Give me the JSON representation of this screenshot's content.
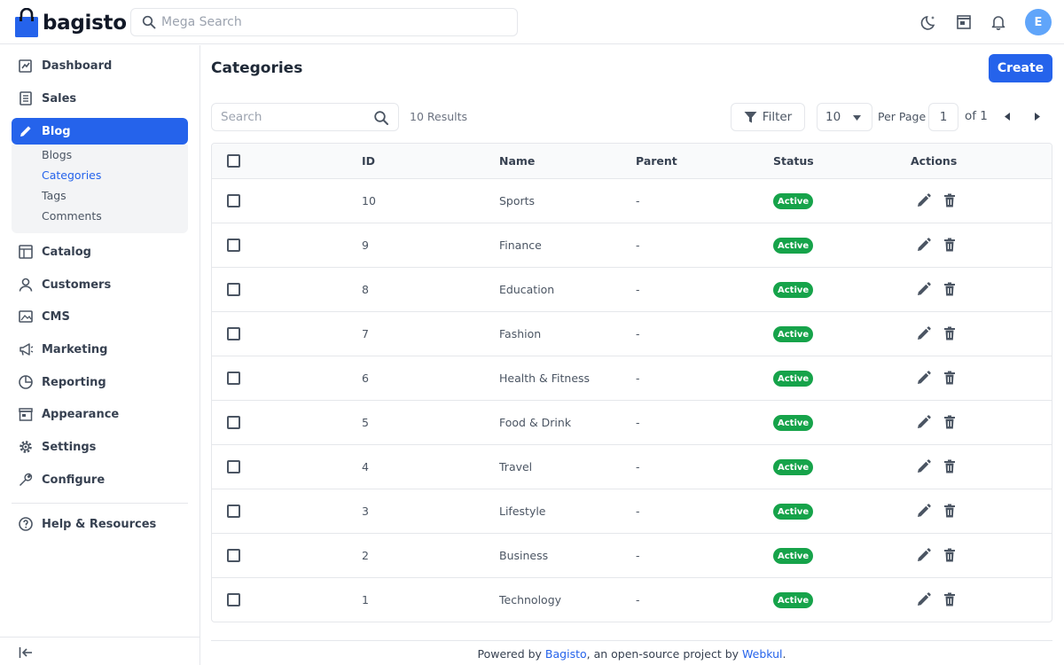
{
  "brand": {
    "name": "bagisto",
    "accent": "#2563eb"
  },
  "top_search": {
    "placeholder": "Mega Search"
  },
  "user": {
    "initial": "E"
  },
  "sidebar": {
    "items": [
      {
        "label": "Dashboard",
        "icon": "dashboard-icon"
      },
      {
        "label": "Sales",
        "icon": "sales-icon"
      },
      {
        "label": "Blog",
        "icon": "pencil-icon",
        "active": true
      },
      {
        "label": "Catalog",
        "icon": "catalog-icon"
      },
      {
        "label": "Customers",
        "icon": "customer-icon"
      },
      {
        "label": "CMS",
        "icon": "cms-icon"
      },
      {
        "label": "Marketing",
        "icon": "megaphone-icon"
      },
      {
        "label": "Reporting",
        "icon": "chart-icon"
      },
      {
        "label": "Appearance",
        "icon": "store-icon"
      },
      {
        "label": "Settings",
        "icon": "gear-icon"
      },
      {
        "label": "Configure",
        "icon": "wrench-icon"
      },
      {
        "label": "Help & Resources",
        "icon": "help-icon"
      }
    ],
    "blog_sub": [
      {
        "label": "Blogs"
      },
      {
        "label": "Categories",
        "current": true
      },
      {
        "label": "Tags"
      },
      {
        "label": "Comments"
      }
    ]
  },
  "page": {
    "title": "Categories",
    "create_label": "Create",
    "search_placeholder": "Search",
    "results_text": "10 Results",
    "filter_label": "Filter",
    "per_page_value": "10",
    "per_page_label": "Per Page",
    "page_value": "1",
    "of_label": "of 1"
  },
  "table": {
    "headers": {
      "id": "ID",
      "name": "Name",
      "parent": "Parent",
      "status": "Status",
      "actions": "Actions"
    },
    "rows": [
      {
        "id": "10",
        "name": "Sports",
        "parent": "-",
        "status": "Active"
      },
      {
        "id": "9",
        "name": "Finance",
        "parent": "-",
        "status": "Active"
      },
      {
        "id": "8",
        "name": "Education",
        "parent": "-",
        "status": "Active"
      },
      {
        "id": "7",
        "name": "Fashion",
        "parent": "-",
        "status": "Active"
      },
      {
        "id": "6",
        "name": "Health & Fitness",
        "parent": "-",
        "status": "Active"
      },
      {
        "id": "5",
        "name": "Food & Drink",
        "parent": "-",
        "status": "Active"
      },
      {
        "id": "4",
        "name": "Travel",
        "parent": "-",
        "status": "Active"
      },
      {
        "id": "3",
        "name": "Lifestyle",
        "parent": "-",
        "status": "Active"
      },
      {
        "id": "2",
        "name": "Business",
        "parent": "-",
        "status": "Active"
      },
      {
        "id": "1",
        "name": "Technology",
        "parent": "-",
        "status": "Active"
      }
    ]
  },
  "footer": {
    "prefix": "Powered by ",
    "link1": "Bagisto",
    "middle": ", an open-source project by ",
    "link2": "Webkul",
    "suffix": "."
  }
}
